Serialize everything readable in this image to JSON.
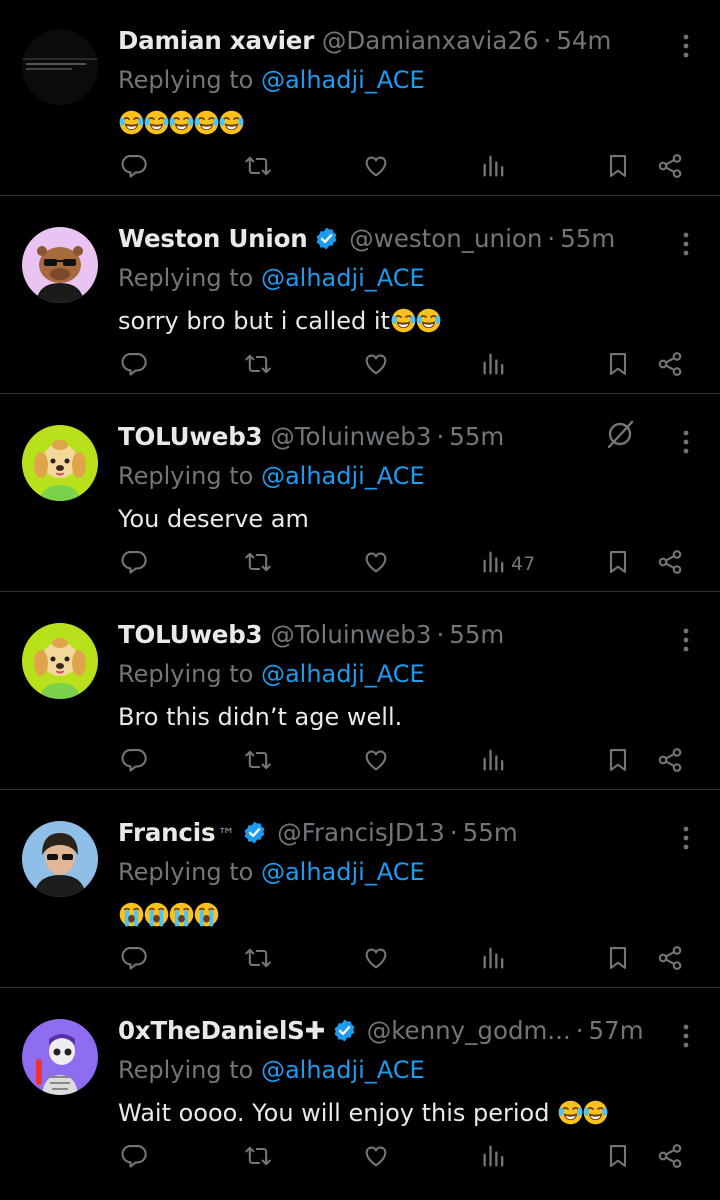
{
  "tweets": [
    {
      "name": "Damian xavier",
      "suffix": "",
      "verified": false,
      "handle": "@Damianxavia26",
      "time": "54m",
      "reply_prefix": "Replying to ",
      "reply_to": "@alhadji_ACE",
      "text": "",
      "emojis": [
        "joy",
        "joy",
        "joy",
        "joy",
        "joy"
      ],
      "views": "",
      "avatar": "dark-screenshot"
    },
    {
      "name": "Weston Union",
      "suffix": "",
      "verified": true,
      "handle": "@weston_union",
      "time": "55m",
      "reply_prefix": "Replying to ",
      "reply_to": "@alhadji_ACE",
      "text": "sorry bro but i called it",
      "emojis": [
        "joy",
        "joy"
      ],
      "views": "",
      "avatar": "capybara"
    },
    {
      "name": "TOLUweb3",
      "suffix": "",
      "verified": false,
      "handle": "@Toluinweb3",
      "time": "55m",
      "reply_prefix": "Replying to ",
      "reply_to": "@alhadji_ACE",
      "text": "You deserve am",
      "emojis": [],
      "views": "47",
      "avatar": "dog",
      "grok_icon": true
    },
    {
      "name": "TOLUweb3",
      "suffix": "",
      "verified": false,
      "handle": "@Toluinweb3",
      "time": "55m",
      "reply_prefix": "Replying to ",
      "reply_to": "@alhadji_ACE",
      "text": "Bro this didn’t age well.",
      "emojis": [],
      "views": "",
      "avatar": "dog"
    },
    {
      "name": "Francis",
      "suffix": "™",
      "verified": true,
      "handle": "@FrancisJD13",
      "time": "55m",
      "reply_prefix": "Replying to ",
      "reply_to": "@alhadji_ACE",
      "text": "",
      "emojis": [
        "sob",
        "sob",
        "sob",
        "sob"
      ],
      "views": "",
      "avatar": "person"
    },
    {
      "name": "0xTheDanielS✚",
      "suffix": "",
      "verified": true,
      "handle": "@kenny_godm...",
      "time": "57m",
      "reply_prefix": "Replying to ",
      "reply_to": "@alhadji_ACE",
      "text": "Wait oooo. You will enjoy this period ",
      "emojis": [
        "joy",
        "joy"
      ],
      "views": "",
      "avatar": "skeleton"
    }
  ],
  "colors": {
    "background": "#000000",
    "primary_text": "#e7e9ea",
    "secondary_text": "#71767b",
    "mention": "#1d9bf0",
    "verified": "#1d9bf0",
    "divider": "#2f3336"
  },
  "icons": [
    "reply-icon",
    "retweet-icon",
    "like-icon",
    "views-icon",
    "bookmark-icon",
    "share-icon",
    "more-icon",
    "grok-icon",
    "verified-badge-icon"
  ]
}
